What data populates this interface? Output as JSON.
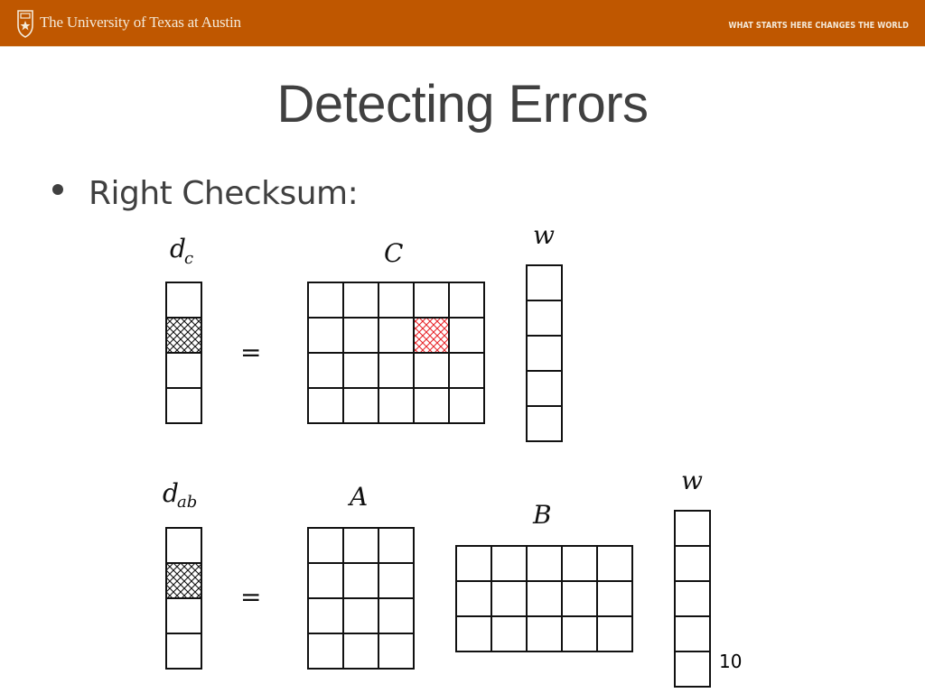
{
  "header": {
    "university_name": "The University of Texas at Austin",
    "tagline": "WHAT STARTS HERE CHANGES THE WORLD",
    "logo_icon": "ut-shield-icon",
    "brand_color": "#BF5700"
  },
  "slide": {
    "title": "Detecting Errors",
    "bullets": [
      {
        "text": "Right Checksum:"
      }
    ],
    "page_number": "10"
  },
  "diagram": {
    "equations": [
      {
        "name": "top",
        "lhs": {
          "label": "d",
          "subscript": "c",
          "rows": 4,
          "cols": 1,
          "hatched": [
            [
              1,
              0
            ]
          ]
        },
        "equals": "=",
        "rhs": [
          {
            "label": "C",
            "rows": 4,
            "cols": 5,
            "hatched_red": [
              [
                1,
                3
              ]
            ]
          },
          {
            "label": "w",
            "rows": 5,
            "cols": 1
          }
        ]
      },
      {
        "name": "bottom",
        "lhs": {
          "label": "d",
          "subscript": "ab",
          "rows": 4,
          "cols": 1,
          "hatched": [
            [
              1,
              0
            ]
          ]
        },
        "equals": "=",
        "rhs": [
          {
            "label": "A",
            "rows": 4,
            "cols": 3
          },
          {
            "label": "B",
            "rows": 3,
            "cols": 5
          },
          {
            "label": "w",
            "rows": 5,
            "cols": 1
          }
        ]
      }
    ],
    "colors": {
      "grid": "#111111",
      "hatch": "#111111",
      "error_hatch": "#e8262b"
    }
  }
}
